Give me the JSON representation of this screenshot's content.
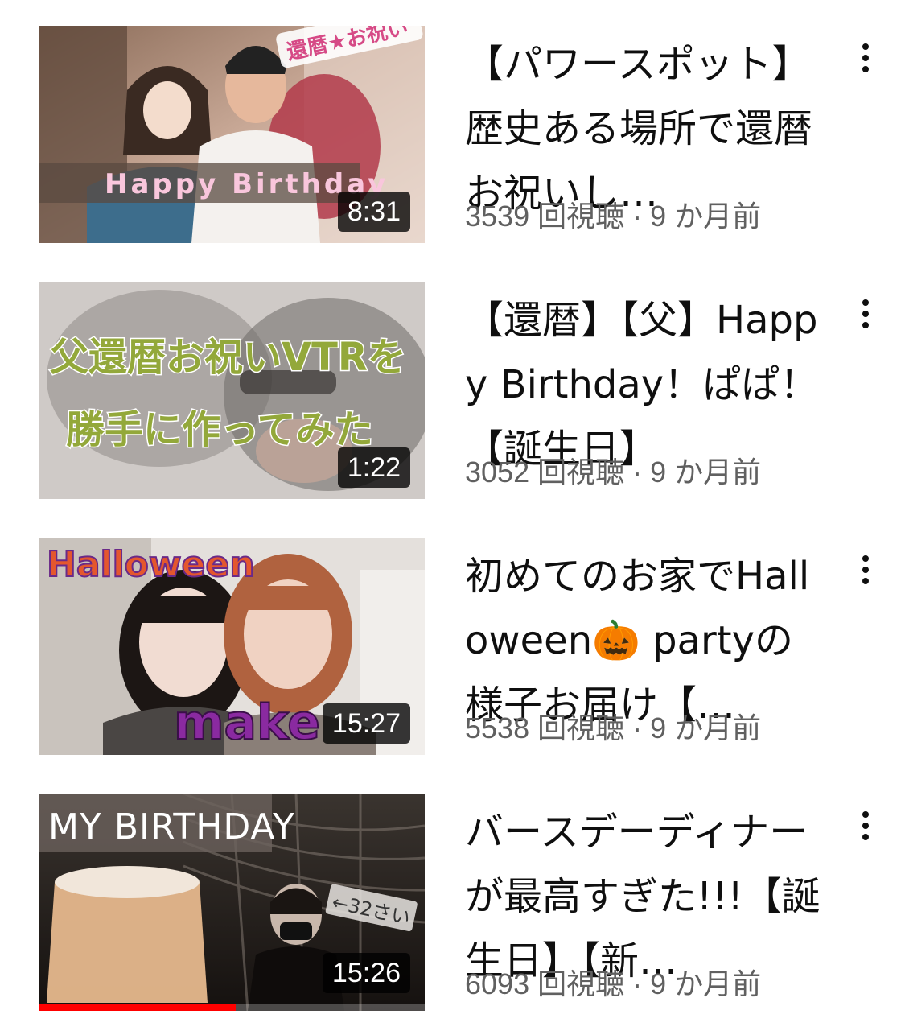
{
  "videos": [
    {
      "title": "【パワースポット】歴史ある場所で還暦お祝いし…",
      "views": "3539 回視聴",
      "separator": "·",
      "age": "9 か月前",
      "duration": "8:31",
      "thumbnail_text": [
        "還暦★お祝い",
        "Happy Birthday"
      ]
    },
    {
      "title": "【還暦】【父】Happy Birthday！ぱぱ！【誕生日】",
      "views": "3052 回視聴",
      "separator": "·",
      "age": "9 か月前",
      "duration": "1:22",
      "thumbnail_text": [
        "父還暦お祝いVTRを",
        "勝手に作ってみた"
      ]
    },
    {
      "title": "初めてのお家でHalloween🎃 partyの様子お届け【…",
      "views": "5538 回視聴",
      "separator": "·",
      "age": "9 か月前",
      "duration": "15:27",
      "thumbnail_text": [
        "Halloween",
        "make"
      ]
    },
    {
      "title": "バースデーディナーが最高すぎた!!!【誕生日】【新…",
      "views": "6093 回視聴",
      "separator": "·",
      "age": "9 か月前",
      "duration": "15:26",
      "thumbnail_text": [
        "MY BIRTHDAY",
        "←32さい"
      ],
      "watch_progress": 0.51
    }
  ],
  "icons": {
    "more": "more-vert-icon"
  },
  "colors": {
    "progress": "#ff0000",
    "meta_text": "#606060",
    "title_text": "#0f0f0f"
  }
}
